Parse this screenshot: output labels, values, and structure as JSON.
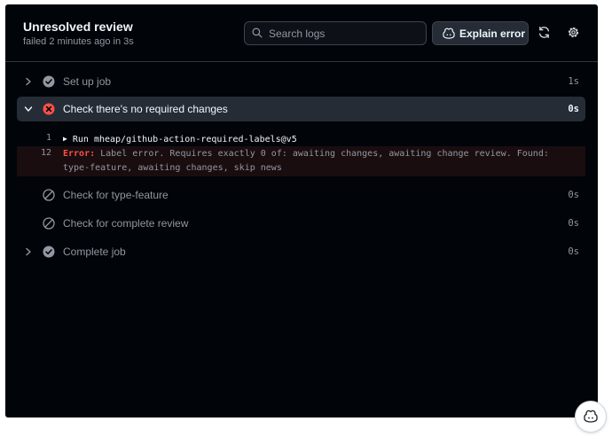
{
  "header": {
    "title": "Unresolved review",
    "subtitle": "failed 2 minutes ago in 3s",
    "search_placeholder": "Search logs",
    "explain_label": "Explain error"
  },
  "steps": [
    {
      "name": "Set up job",
      "duration": "1s",
      "status": "success",
      "expanded": false
    },
    {
      "name": "Check there's no required changes",
      "duration": "0s",
      "status": "failure",
      "expanded": true
    },
    {
      "name": "Check for type-feature",
      "duration": "0s",
      "status": "skipped",
      "expanded": false
    },
    {
      "name": "Check for complete review",
      "duration": "0s",
      "status": "skipped",
      "expanded": false
    },
    {
      "name": "Complete job",
      "duration": "0s",
      "status": "success",
      "expanded": false
    }
  ],
  "log": {
    "run": {
      "line": "1",
      "text": "Run mheap/github-action-required-labels@v5"
    },
    "error": {
      "line": "12",
      "keyword": "Error:",
      "message": " Label error. Requires exactly 0 of: awaiting changes, awaiting change review. Found: type-feature, awaiting changes, skip news"
    }
  },
  "colors": {
    "background": "#010409",
    "active_row": "#262c36",
    "error": "#f85149",
    "muted": "#9198a1"
  },
  "icons": [
    "search-icon",
    "copilot-icon",
    "refresh-icon",
    "gear-icon",
    "chevron-right-icon",
    "chevron-down-icon",
    "check-circle-icon",
    "x-circle-icon",
    "skip-icon",
    "triangle-right-icon"
  ]
}
